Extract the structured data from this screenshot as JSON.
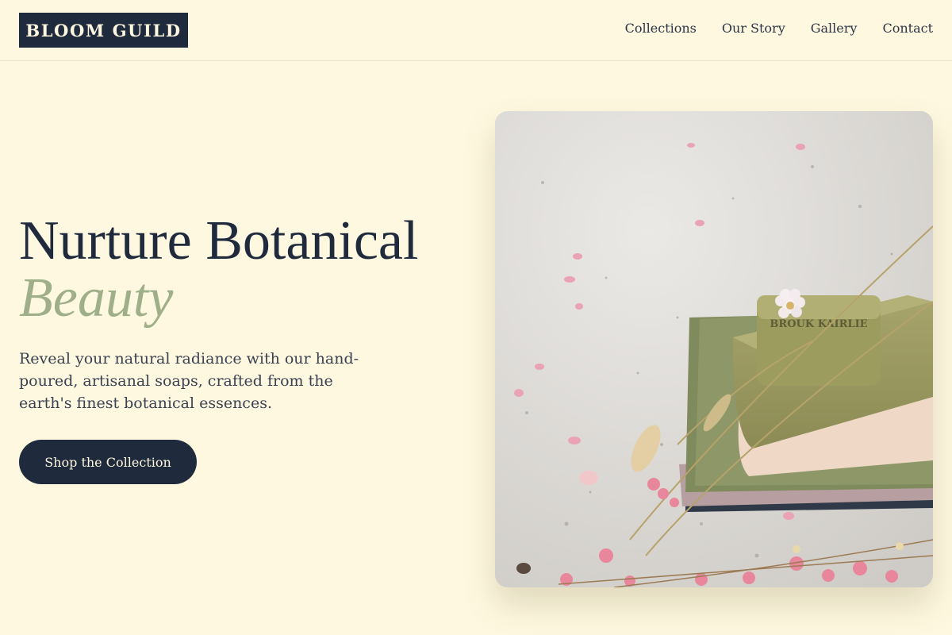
{
  "brand": {
    "name": "BLOOM GUILD"
  },
  "nav": {
    "items": [
      {
        "label": "Collections"
      },
      {
        "label": "Our Story"
      },
      {
        "label": "Gallery"
      },
      {
        "label": "Contact"
      }
    ]
  },
  "hero": {
    "title_line1": "Nurture Botanical",
    "title_line2": "Beauty",
    "description": "Reveal your natural radiance with our hand-poured, artisanal soaps, crafted from the earth's finest botanical essences.",
    "cta_label": "Shop the Collection",
    "image_stamp": "BROUK KAIRLIE"
  },
  "colors": {
    "background": "#fef8e0",
    "primary": "#1f2a3d",
    "accent_sage": "#9faf89"
  }
}
